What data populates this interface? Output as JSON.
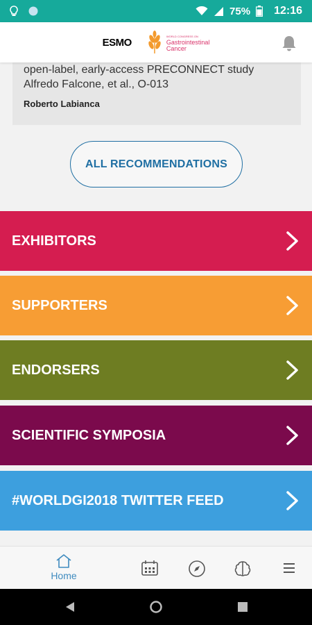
{
  "status_bar": {
    "battery": "75%",
    "time": "12:16",
    "bg_color": "#16aa9b"
  },
  "header": {
    "logo_esmo": "ESMO",
    "logo_line1": "World Congress on",
    "logo_line2": "Gastrointestinal",
    "logo_line3": "Cancer",
    "notification_icon": "bell-icon"
  },
  "card": {
    "line1": "open-label, early-access PRECONNECT study",
    "line2": "Alfredo Falcone, et al., O-013",
    "author": "Roberto Labianca"
  },
  "all_recommendations_label": "ALL RECOMMENDATIONS",
  "menu": [
    {
      "label": "EXHIBITORS",
      "color": "#d51d50"
    },
    {
      "label": "SUPPORTERS",
      "color": "#f79d34"
    },
    {
      "label": "ENDORSERS",
      "color": "#6e7d22"
    },
    {
      "label": "SCIENTIFIC SYMPOSIA",
      "color": "#7b0a4c"
    },
    {
      "label": "#WORLDGI2018 TWITTER FEED",
      "color": "#3d9fde"
    }
  ],
  "bottom_nav": {
    "home_label": "Home",
    "icons": [
      "home-icon",
      "calendar-icon",
      "compass-icon",
      "brain-icon",
      "menu-icon"
    ]
  }
}
